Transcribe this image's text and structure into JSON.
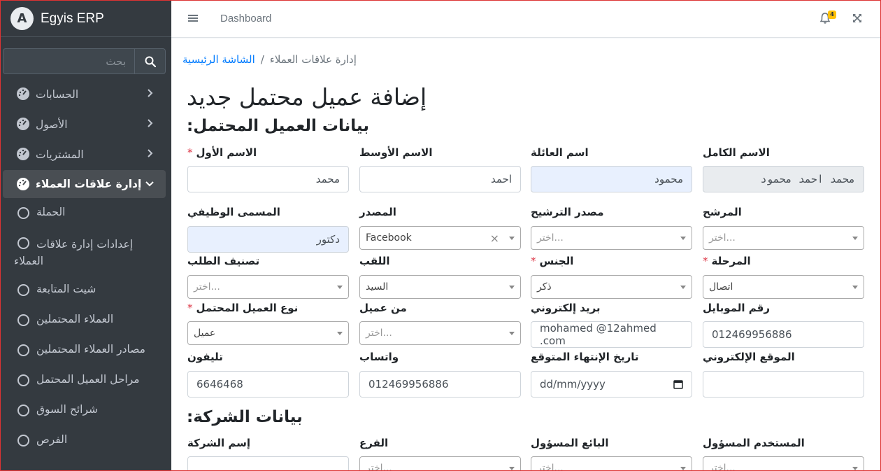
{
  "brand": {
    "logo_letter": "A",
    "name": "Egyis ERP"
  },
  "search": {
    "placeholder": "بحث"
  },
  "sidebar": {
    "items": [
      {
        "label": "الحسابات"
      },
      {
        "label": "الأصول"
      },
      {
        "label": "المشتريات"
      },
      {
        "label": "إدارة علاقات العملاء"
      }
    ],
    "sub_items": [
      {
        "label": "الحملة"
      },
      {
        "label_line1": "إعدادات إدارة علاقات",
        "label_line2": "العملاء"
      },
      {
        "label": "شيت المتابعة"
      },
      {
        "label": "العملاء المحتملين"
      },
      {
        "label": "مصادر العملاء المحتملين"
      },
      {
        "label": "مراحل العميل المحتمل"
      },
      {
        "label": "شرائح السوق"
      },
      {
        "label": "الفرص"
      }
    ]
  },
  "topbar": {
    "link": "Dashboard",
    "notif_count": "4"
  },
  "breadcrumb": {
    "home": "الشاشة الرئيسية",
    "current": "إدارة علاقات العملاء",
    "sep": "/"
  },
  "page": {
    "title": "إضافة عميل محتمل جديد",
    "section1": "بيانات العميل المحتمل:",
    "section2": "بيانات الشركة:"
  },
  "form": {
    "full_name": {
      "label": "الاسم الكامل",
      "value": "محمد احمد محمود"
    },
    "family_name": {
      "label": "اسم العائلة",
      "value": "محمود"
    },
    "middle_name": {
      "label": "الاسم الأوسط",
      "value": "احمد"
    },
    "first_name": {
      "label": "الاسم الأول",
      "value": "محمد",
      "req": "*"
    },
    "referrer": {
      "label": "المرشح",
      "value": "اختر..."
    },
    "ref_source": {
      "label": "مصدر الترشيح",
      "value": "اختر..."
    },
    "source": {
      "label": "المصدر",
      "value": "Facebook"
    },
    "job_title": {
      "label": "المسمى الوظيفي",
      "value": "دكتور"
    },
    "stage": {
      "label": "المرحلة",
      "value": "اتصال",
      "req": "*"
    },
    "gender": {
      "label": "الجنس",
      "value": "ذكر",
      "req": "*"
    },
    "title": {
      "label": "اللقب",
      "value": "السيد"
    },
    "request_class": {
      "label": "تصنيف الطلب",
      "value": "اختر..."
    },
    "mobile": {
      "label": "رقم الموبايل",
      "value": "012469956886"
    },
    "email": {
      "label": "بريد إلكتروني",
      "value": "mohamed @12ahmed .com"
    },
    "from_client": {
      "label": "من عميل",
      "value": "اختر..."
    },
    "lead_type": {
      "label": "نوع العميل المحتمل",
      "value": "عميل",
      "req": "*"
    },
    "website": {
      "label": "الموقع الإلكتروني",
      "value": ""
    },
    "expected_end": {
      "label": "تاريخ الإنتهاء المتوقع",
      "value": "dd/mm/yyyy"
    },
    "whatsapp": {
      "label": "واتساب",
      "value": "012469956886"
    },
    "phone": {
      "label": "تليفون",
      "value": "6646468"
    },
    "responsible_user": {
      "label": "المستخدم المسؤول",
      "value": "اختر..."
    },
    "responsible_seller": {
      "label": "البائع المسؤول",
      "value": "اختر..."
    },
    "branch": {
      "label": "الفرع",
      "value": "اختر..."
    },
    "company_name": {
      "label": "إسم الشركة",
      "value": ""
    }
  },
  "icons": {
    "search": "search-icon",
    "nav": "tachometer-icon",
    "chevron": "chevron-icon",
    "bell": "bell-icon",
    "expand": "expand-icon",
    "menu": "menu-icon"
  },
  "colors": {
    "sidebar": "#343a40",
    "link": "#007bff",
    "required": "#dc3545",
    "badge": "#ffc107",
    "highlight": "#e8f0fe"
  }
}
